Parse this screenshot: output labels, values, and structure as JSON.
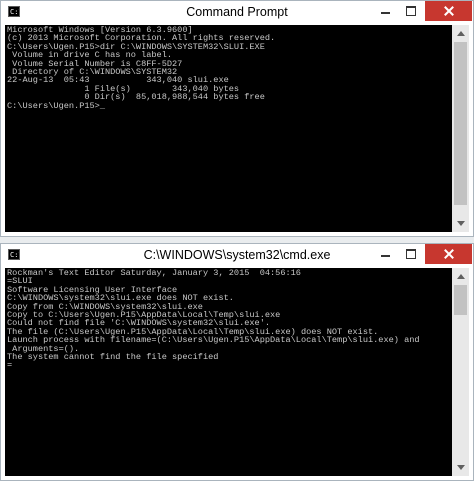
{
  "window1": {
    "icon_text": "C:\\",
    "title": "Command Prompt",
    "lines": [
      "Microsoft Windows [Version 6.3.9600]",
      "(c) 2013 Microsoft Corporation. All rights reserved.",
      "",
      "C:\\Users\\Ugen.P15>dir C:\\WINDOWS\\SYSTEM32\\SLUI.EXE",
      " Volume in drive C has no label.",
      " Volume Serial Number is C8FF-5D27",
      "",
      " Directory of C:\\WINDOWS\\SYSTEM32",
      "",
      "22-Aug-13  05:43           343,040 slui.exe",
      "               1 File(s)        343,040 bytes",
      "               0 Dir(s)  85,018,988,544 bytes free",
      "",
      "C:\\Users\\Ugen.P15>_"
    ]
  },
  "window2": {
    "icon_text": "C:\\",
    "title": "C:\\WINDOWS\\system32\\cmd.exe",
    "lines": [
      "Rockman's Text Editor Saturday, January 3, 2015  04:56:16",
      "=SLUI",
      "Software Licensing User Interface",
      "C:\\WINDOWS\\system32\\slui.exe does NOT exist.",
      "Copy from C:\\WINDOWS\\system32\\slui.exe",
      "Copy to C:\\Users\\Ugen.P15\\AppData\\Local\\Temp\\slui.exe",
      "Could not find file 'C:\\WINDOWS\\system32\\slui.exe'.",
      "The file (C:\\Users\\Ugen.P15\\AppData\\Local\\Temp\\slui.exe) does NOT exist.",
      "Launch process with filename=(C:\\Users\\Ugen.P15\\AppData\\Local\\Temp\\slui.exe) and",
      " Arguments=().",
      "The system cannot find the file specified",
      "="
    ]
  },
  "colors": {
    "console_background": "#000000",
    "console_text": "#c8c8c8",
    "close_button": "#c7372f",
    "window_border": "#aab4bd"
  }
}
